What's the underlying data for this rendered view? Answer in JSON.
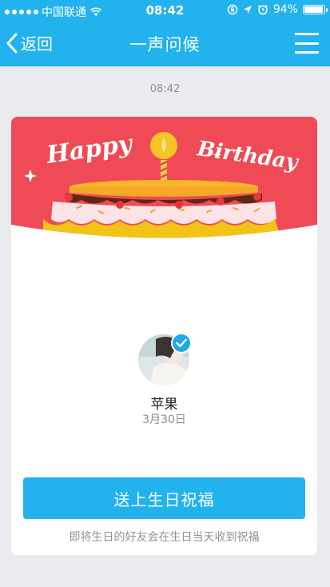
{
  "status_bar": {
    "carrier": "中国联通",
    "time": "08:42",
    "battery": "94%",
    "battery_level": 0.94
  },
  "nav": {
    "back_label": "返回",
    "title": "一声问候",
    "menu_icon": "hamburger-menu-icon"
  },
  "message_time": "08:42",
  "card": {
    "banner": {
      "text_left": "Happy",
      "text_right": "Birthday",
      "colors": {
        "background": "#ef4a55",
        "cake_top": "#f7a826",
        "cake_base": "#f2c417",
        "frosting": "#fbe3e6",
        "chocolate": "#5a2a14"
      }
    },
    "friend": {
      "name": "苹果",
      "birthday": "3月30日",
      "verified_icon": "check-icon"
    },
    "send_button": "送上生日祝福",
    "hint": "即将生日的好友会在生日当天收到祝福"
  },
  "colors": {
    "accent": "#22b2ee",
    "page_bg": "#eaebef"
  }
}
